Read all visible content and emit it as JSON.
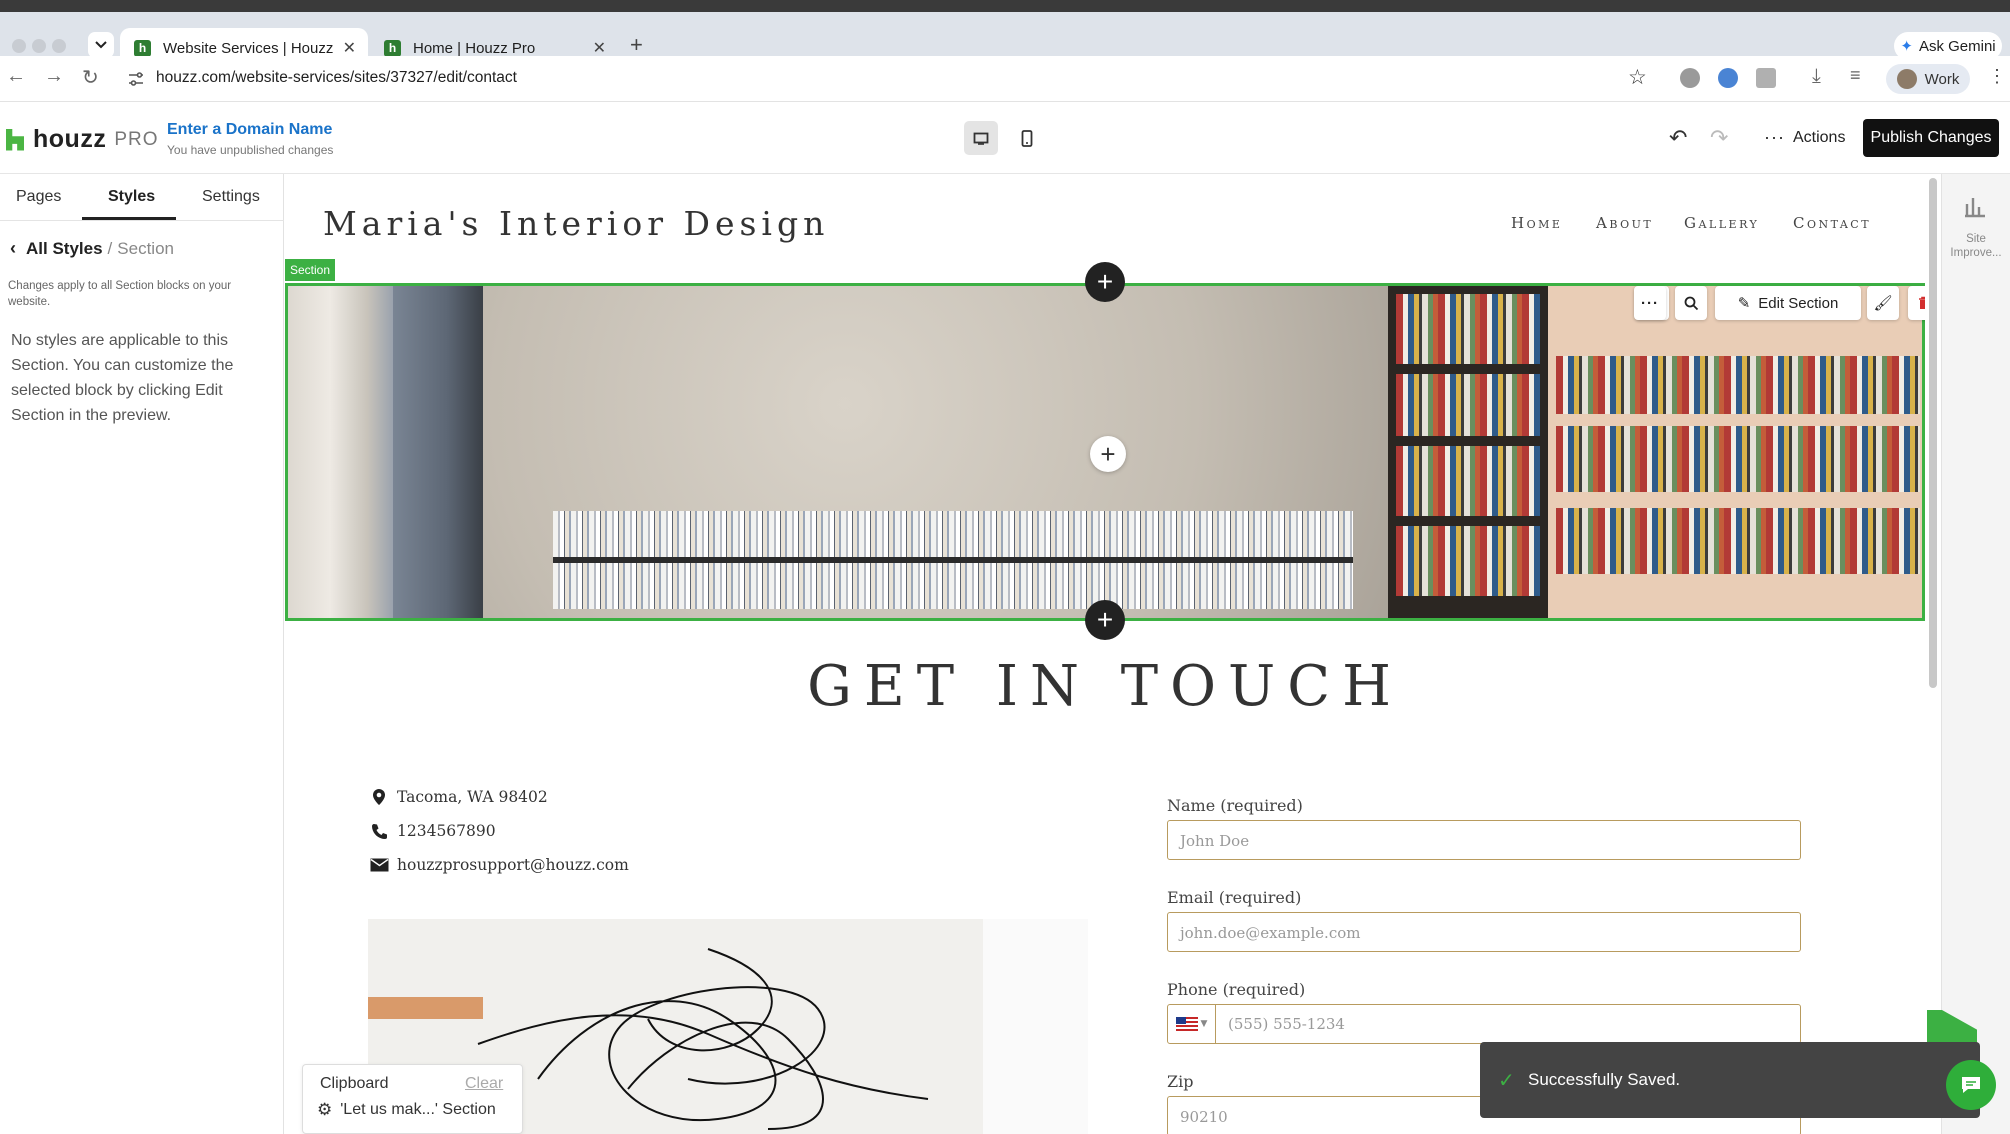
{
  "browser": {
    "tabs": [
      {
        "title": "Website Services | Houzz",
        "favicon": "houzz-icon",
        "active": true
      },
      {
        "title": "Home | Houzz Pro",
        "favicon": "houzz-icon",
        "active": false
      }
    ],
    "new_tab": "+",
    "ask_gemini": "Ask Gemini",
    "url": "houzz.com/website-services/sites/37327/edit/contact",
    "profile": "Work"
  },
  "app": {
    "logo_text": "houzz",
    "logo_suffix": "PRO",
    "domain_cta": "Enter a Domain Name",
    "unpublished": "You have unpublished changes",
    "actions_label": "Actions",
    "publish_label": "Publish Changes"
  },
  "sidebar": {
    "tabs": [
      {
        "label": "Pages",
        "active": false
      },
      {
        "label": "Styles",
        "active": true
      },
      {
        "label": "Settings",
        "active": false
      }
    ],
    "breadcrumb_root": "All Styles",
    "breadcrumb_sep": "/",
    "breadcrumb_current": "Section",
    "note": "Changes apply to all Section blocks on your website.",
    "no_styles": "No styles are applicable to this Section. You can customize the selected block by clicking Edit Section in the preview."
  },
  "clipboard": {
    "title": "Clipboard",
    "clear": "Clear",
    "item": "'Let us mak...' Section"
  },
  "site": {
    "title": "Maria's Interior Design",
    "nav": [
      "Home",
      "About",
      "Gallery",
      "Contact"
    ],
    "section_label": "Section",
    "edit_section": "Edit Section",
    "heading": "GET IN TOUCH",
    "address": "Tacoma, WA 98402",
    "phone": "1234567890",
    "email": "houzzprosupport@houzz.com",
    "form": {
      "name_label": "Name (required)",
      "name_placeholder": "John Doe",
      "email_label": "Email (required)",
      "email_placeholder": "john.doe@example.com",
      "phone_label": "Phone (required)",
      "phone_placeholder": "(555) 555-1234",
      "zip_label": "Zip",
      "zip_placeholder": "90210"
    }
  },
  "right_panel": {
    "label": "Site Improve..."
  },
  "toast": {
    "message": "Successfully Saved."
  },
  "colors": {
    "accent": "#3cb043",
    "link": "#1a73c9",
    "publish_bg": "#111111",
    "input_border": "#b89b5e"
  }
}
